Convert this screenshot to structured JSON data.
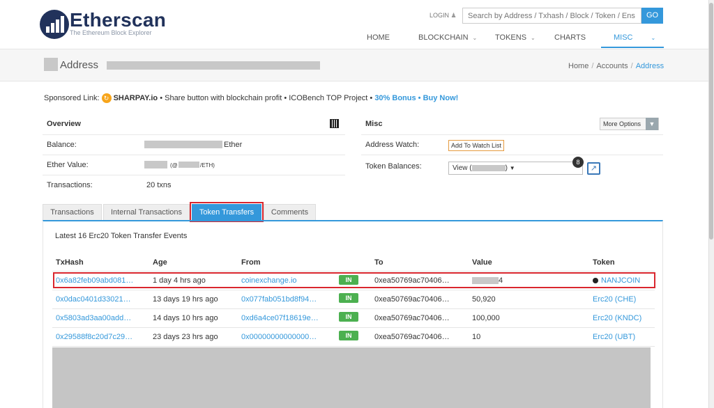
{
  "header": {
    "logo_text": "Etherscan",
    "logo_sub": "The Ethereum Block Explorer",
    "login": "LOGIN",
    "search_placeholder": "Search by Address / Txhash / Block / Token / Ens",
    "go": "GO",
    "nav": [
      "HOME",
      "BLOCKCHAIN",
      "TOKENS",
      "CHARTS",
      "MISC"
    ],
    "accent": "#3498db"
  },
  "title_band": {
    "title": "Address",
    "breadcrumb": [
      "Home",
      "Accounts",
      "Address"
    ]
  },
  "sponsor": {
    "prefix": "Sponsored Link:",
    "brand": "SHARPAY.io",
    "text": "• Share button with blockchain profit • ICOBench TOP Project •",
    "cta": "30% Bonus • Buy Now!"
  },
  "overview": {
    "title": "Overview",
    "balance_label": "Balance:",
    "balance_unit": "Ether",
    "ether_value_label": "Ether Value:",
    "ether_value_paren_open": "(@",
    "ether_value_paren_close": "/ETH)",
    "transactions_label": "Transactions:",
    "transactions_value": "20 txns"
  },
  "misc": {
    "title": "Misc",
    "more_options": "More Options",
    "address_watch_label": "Address Watch:",
    "watch_button": "Add To Watch List",
    "token_balances_label": "Token Balances:",
    "token_select_prefix": "View (",
    "token_select_suffix": ")",
    "token_count": "8"
  },
  "tabs": [
    "Transactions",
    "Internal Transactions",
    "Token Transfers",
    "Comments"
  ],
  "transfers": {
    "heading": "Latest 16 Erc20 Token Transfer Events",
    "columns": [
      "TxHash",
      "Age",
      "From",
      "",
      "To",
      "Value",
      "Token"
    ],
    "rows": [
      {
        "txhash": "0x6a82feb09abd081…",
        "age": "1 day 4 hrs ago",
        "from": "coinexchange.io",
        "dir": "IN",
        "to": "0xea50769ac70406…",
        "value": "4",
        "token": "NANJCOIN"
      },
      {
        "txhash": "0x0dac0401d33021…",
        "age": "13 days 19 hrs ago",
        "from": "0x077fab051bd8f94…",
        "dir": "IN",
        "to": "0xea50769ac70406…",
        "value": "50,920",
        "token": "Erc20 (CHE)"
      },
      {
        "txhash": "0x5803ad3aa00add…",
        "age": "14 days 10 hrs ago",
        "from": "0xd6a4ce07f18619e…",
        "dir": "IN",
        "to": "0xea50769ac70406…",
        "value": "100,000",
        "token": "Erc20 (KNDC)"
      },
      {
        "txhash": "0x29588f8c20d7c29…",
        "age": "23 days 23 hrs ago",
        "from": "0x00000000000000…",
        "dir": "IN",
        "to": "0xea50769ac70406…",
        "value": "10",
        "token": "Erc20 (UBT)"
      }
    ]
  }
}
